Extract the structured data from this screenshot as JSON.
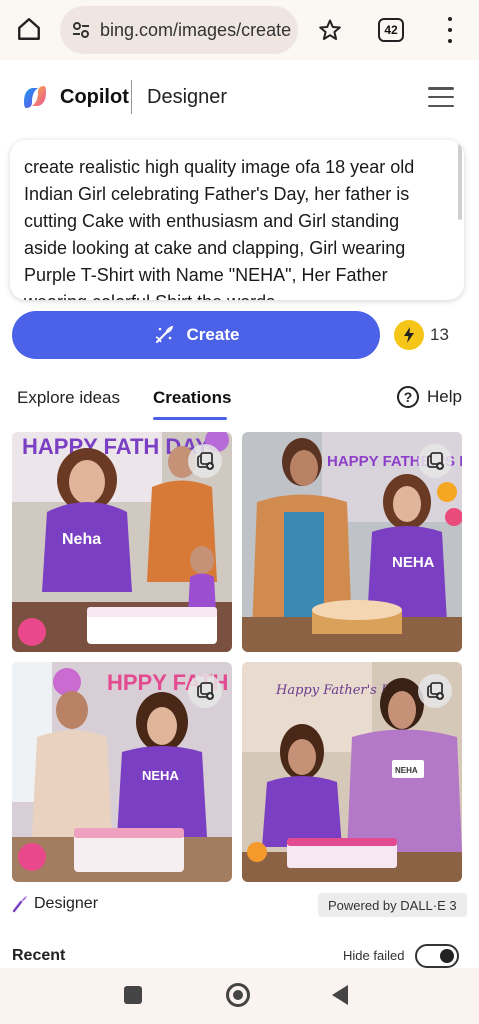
{
  "browser": {
    "url": "bing.com/images/create",
    "tab_count": "42",
    "icons": [
      "home-icon",
      "site-settings-icon",
      "star-icon",
      "tabs-icon",
      "more-vert-icon"
    ]
  },
  "header": {
    "brand": "Copilot",
    "section": "Designer"
  },
  "prompt": {
    "text": "create realistic high quality image ofa 18 year old Indian Girl celebrating Father's Day, her father is cutting Cake with enthusiasm and Girl standing aside looking at cake and clapping, Girl wearing Purple T-Shirt with Name \"NEHA\", Her Father wearing colorful Shirt the words"
  },
  "actions": {
    "create_label": "Create",
    "boosts": "13"
  },
  "tabs": {
    "explore": "Explore ideas",
    "creations": "Creations",
    "help": "Help"
  },
  "images": [
    {
      "banner": "HAPPY FATH DAY",
      "shirt": "Neha"
    },
    {
      "banner": "HAPPY FATHER'S DAY",
      "shirt": "NEHA"
    },
    {
      "banner": "HPPY FATH DY",
      "shirt": "NEHA"
    },
    {
      "banner": "Happy Father's Day",
      "shirt": "NEHA"
    }
  ],
  "footer": {
    "designer": "Designer",
    "powered": "Powered by DALL·E 3",
    "recent": "Recent",
    "hide_failed": "Hide failed",
    "hide_failed_on": true
  },
  "colors": {
    "accent": "#4b61e8",
    "boost": "#f5c518",
    "purple": "#7b3fc4"
  }
}
